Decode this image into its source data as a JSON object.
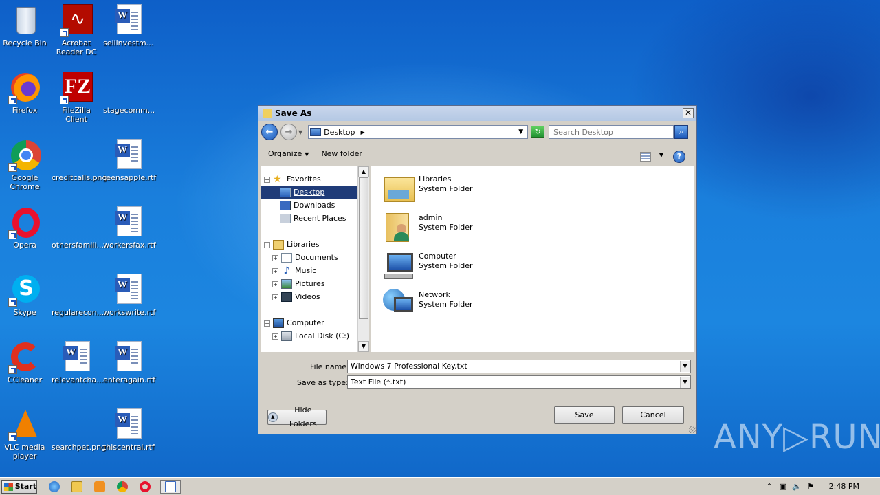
{
  "desktop": {
    "icons": [
      {
        "label": "Recycle Bin"
      },
      {
        "label": "Acrobat Reader DC"
      },
      {
        "label": "sellinvestm..."
      },
      {
        "label": "Firefox"
      },
      {
        "label": "FileZilla Client"
      },
      {
        "label": "stagecomm..."
      },
      {
        "label": "Google Chrome"
      },
      {
        "label": "creditcalls.png"
      },
      {
        "label": "teensapple.rtf"
      },
      {
        "label": "Opera"
      },
      {
        "label": "othersfamili..."
      },
      {
        "label": "workersfax.rtf"
      },
      {
        "label": "Skype"
      },
      {
        "label": "regularecon..."
      },
      {
        "label": "workswrite.rtf"
      },
      {
        "label": "CCleaner"
      },
      {
        "label": "relevantcha..."
      },
      {
        "label": "enteragain.rtf"
      },
      {
        "label": "VLC media player"
      },
      {
        "label": "searchpet.png"
      },
      {
        "label": "thiscentral.rtf"
      }
    ]
  },
  "dialog": {
    "title": "Save As",
    "address": "Desktop",
    "search_placeholder": "Search Desktop",
    "toolbar": {
      "organize": "Organize",
      "new_folder": "New folder"
    },
    "nav": {
      "favorites": "Favorites",
      "desktop": "Desktop",
      "downloads": "Downloads",
      "recent_places": "Recent Places",
      "libraries": "Libraries",
      "documents": "Documents",
      "music": "Music",
      "pictures": "Pictures",
      "videos": "Videos",
      "computer": "Computer",
      "local_disk": "Local Disk (C:)"
    },
    "items": [
      {
        "name": "Libraries",
        "type": "System Folder"
      },
      {
        "name": "admin",
        "type": "System Folder"
      },
      {
        "name": "Computer",
        "type": "System Folder"
      },
      {
        "name": "Network",
        "type": "System Folder"
      }
    ],
    "file_name_label": "File name:",
    "file_name_value": "Windows 7 Professional Key.txt",
    "save_as_type_label": "Save as type:",
    "save_as_type_value": "Text File  (*.txt)",
    "hide_folders": "Hide Folders",
    "save": "Save",
    "cancel": "Cancel"
  },
  "taskbar": {
    "start": "Start",
    "clock": "2:48 PM"
  },
  "watermark": "ANY▷RUN"
}
